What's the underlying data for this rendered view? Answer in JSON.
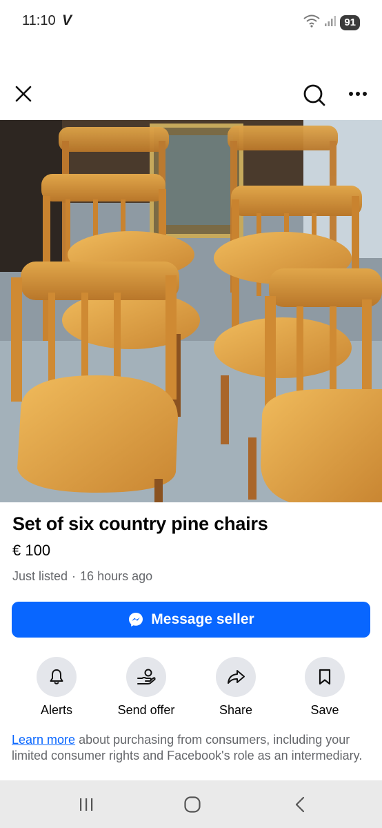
{
  "status_bar": {
    "time": "11:10",
    "carrier_glyph": "V",
    "battery": "91",
    "icons": [
      "wifi-icon",
      "signal-icon",
      "battery-icon"
    ]
  },
  "top_bar": {
    "close_icon": "close-icon",
    "search_icon": "search-icon",
    "more_icon": "more-options-icon"
  },
  "photo": {
    "subject": "listing-photo",
    "carousel": {
      "count": 2,
      "current": 1
    }
  },
  "listing": {
    "title": "Set of six country pine chairs",
    "price": "€ 100",
    "listed_status": "Just listed",
    "separator": "·",
    "listed_time": "16 hours ago"
  },
  "message_button": {
    "label": "Message seller",
    "icon": "messenger-icon"
  },
  "actions": [
    {
      "label": "Alerts",
      "icon": "bell-icon"
    },
    {
      "label": "Send offer",
      "icon": "send-offer-icon"
    },
    {
      "label": "Share",
      "icon": "share-icon"
    },
    {
      "label": "Save",
      "icon": "bookmark-icon"
    }
  ],
  "learn_more": {
    "link": "Learn more",
    "text": " about purchasing from consumers, including your limited consumer rights and Facebook's role as an intermediary."
  },
  "nav_bar": {
    "icons": [
      "recent-apps-icon",
      "home-icon",
      "back-icon"
    ]
  },
  "colors": {
    "accent": "#0866ff",
    "secondary_text": "#65676b",
    "action_circle": "#e4e6eb",
    "nav_bar": "#eaeaea"
  }
}
